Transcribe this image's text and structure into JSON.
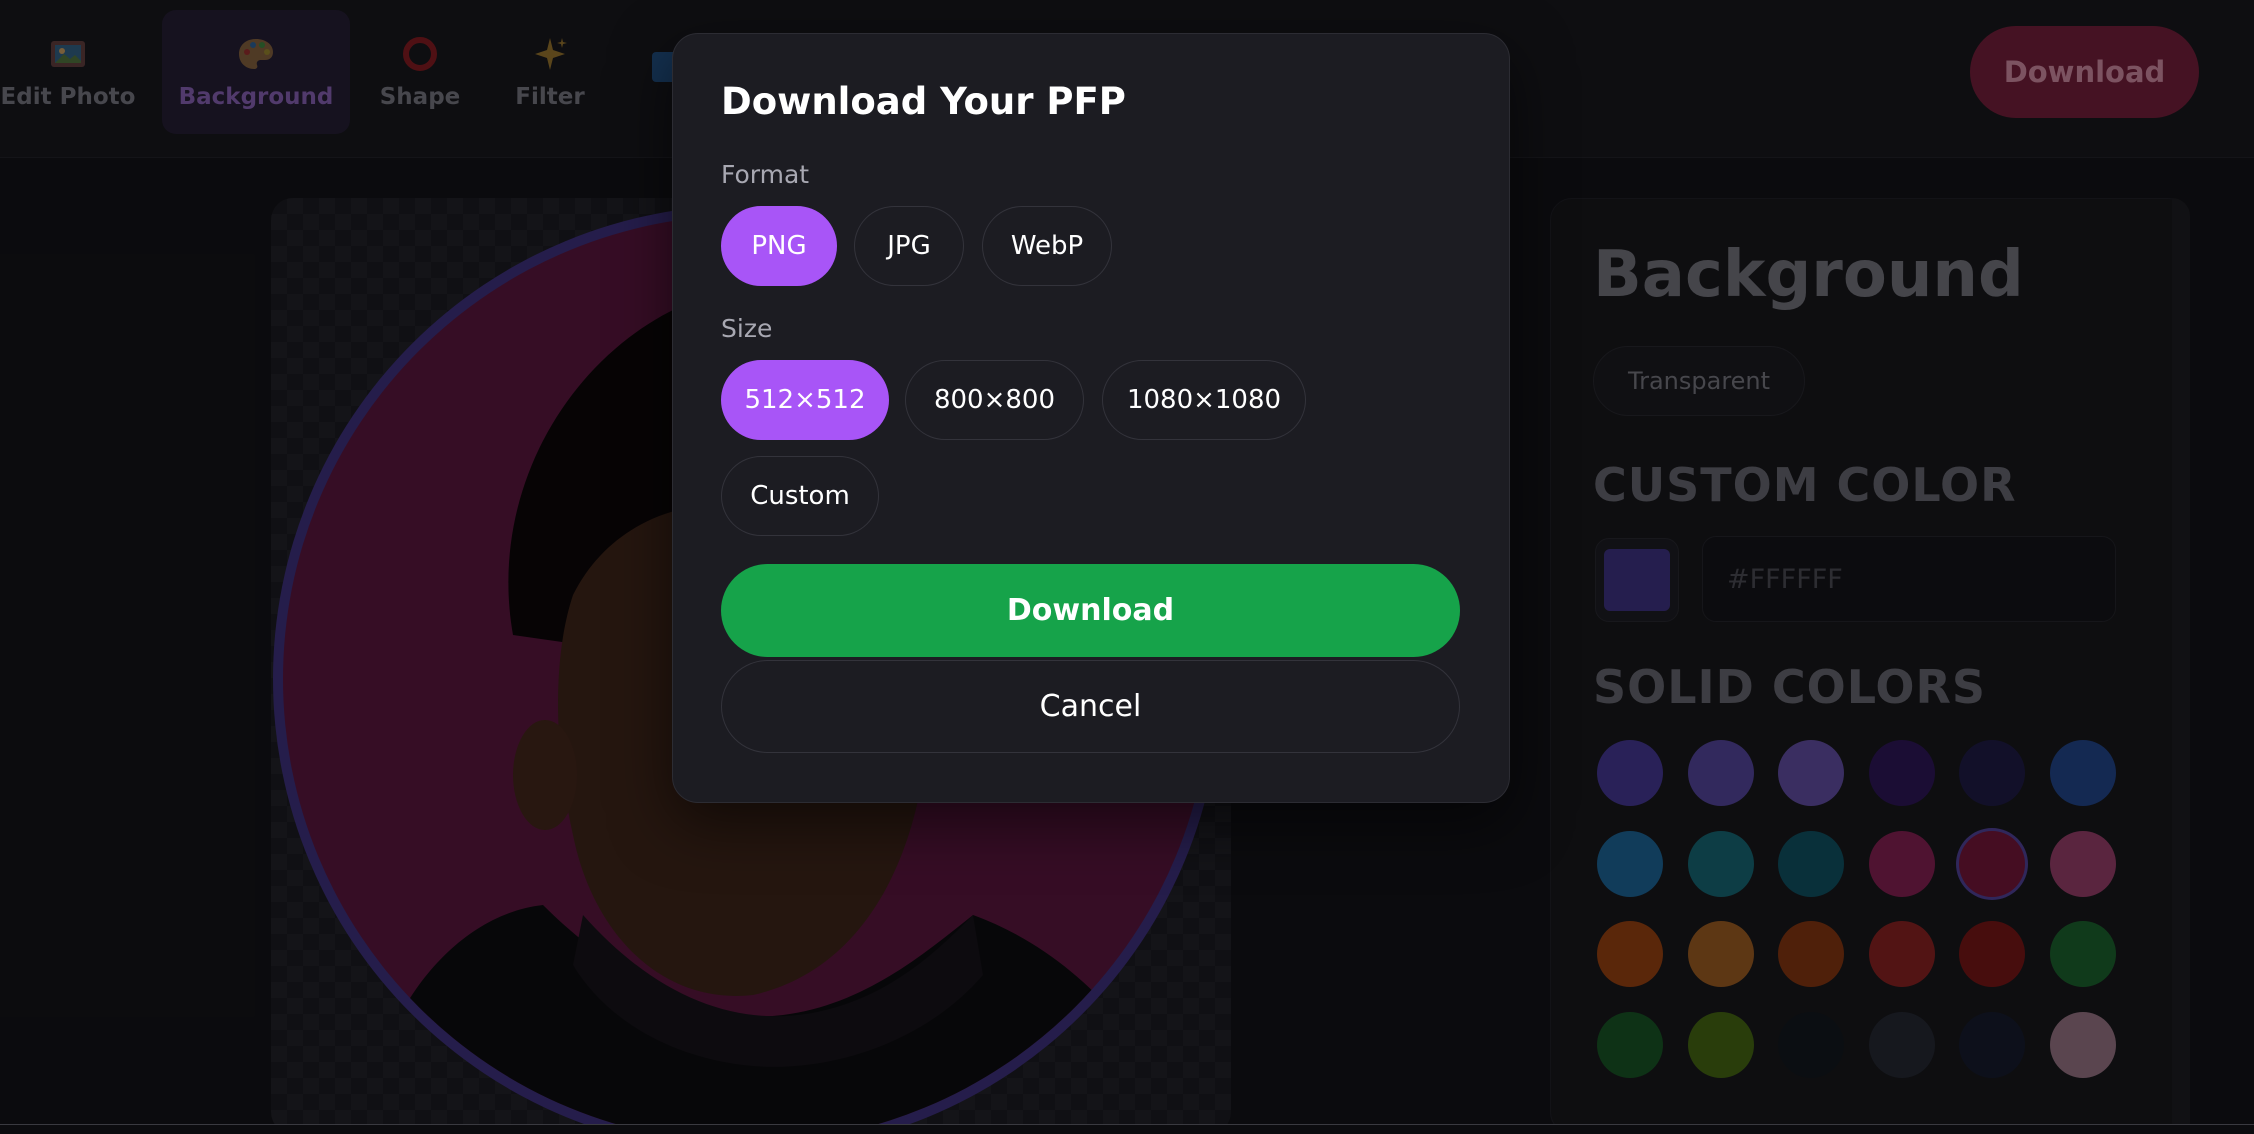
{
  "toolbar": {
    "tools": [
      {
        "label": "Edit Photo",
        "icon": "photo-icon"
      },
      {
        "label": "Background",
        "icon": "palette-icon",
        "active": true
      },
      {
        "label": "Shape",
        "icon": "ring-icon"
      },
      {
        "label": "Filter",
        "icon": "sparkle-icon"
      }
    ],
    "download_label": "Download"
  },
  "panel": {
    "title": "Background",
    "transparent_label": "Transparent",
    "custom_color_heading": "CUSTOM COLOR",
    "hex_placeholder": "#FFFFFF",
    "solid_colors_heading": "SOLID COLORS",
    "swatches": [
      "#3f3488",
      "#4d3f8f",
      "#5a4896",
      "#2a1550",
      "#1c1a40",
      "#1f3f7e",
      "#1b5d8a",
      "#155f6a",
      "#0f4a5a",
      "#7a1e4c",
      "#6b1535",
      "#8a3a62",
      "#8a3c10",
      "#8f5520",
      "#7a3210",
      "#7f2020",
      "#6e1515",
      "#1a5a2a",
      "#164e22",
      "#3f5f12",
      "#12161c",
      "#23262f",
      "#151a2a",
      "#8a6a7a"
    ]
  },
  "modal": {
    "title": "Download Your PFP",
    "format_label": "Format",
    "formats": [
      "PNG",
      "JPG",
      "WebP"
    ],
    "selected_format": "PNG",
    "size_label": "Size",
    "sizes": [
      "512×512",
      "800×800",
      "1080×1080",
      "Custom"
    ],
    "selected_size": "512×512",
    "download_label": "Download",
    "cancel_label": "Cancel"
  },
  "colors": {
    "accent_purple": "#a855f7",
    "download_green": "#16a34a",
    "modal_bg": "#1c1c22"
  }
}
